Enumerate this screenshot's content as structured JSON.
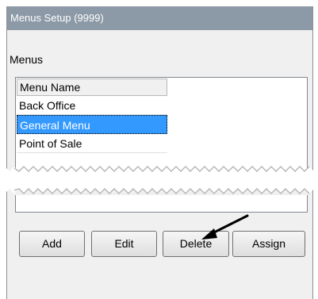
{
  "window": {
    "title": "Menus Setup (9999)"
  },
  "menus_section": {
    "label": "Menus",
    "column_header": "Menu Name",
    "rows": [
      "Back Office",
      "General Menu",
      "Point of Sale"
    ],
    "selected_row": "General Menu"
  },
  "buttons": {
    "add": "Add",
    "edit": "Edit",
    "delete": "Delete",
    "assign": "Assign"
  },
  "colors": {
    "titlebar": "#8c99a6",
    "selection": "#3399ff"
  },
  "icons": [
    "pointer-arrow-icon"
  ]
}
